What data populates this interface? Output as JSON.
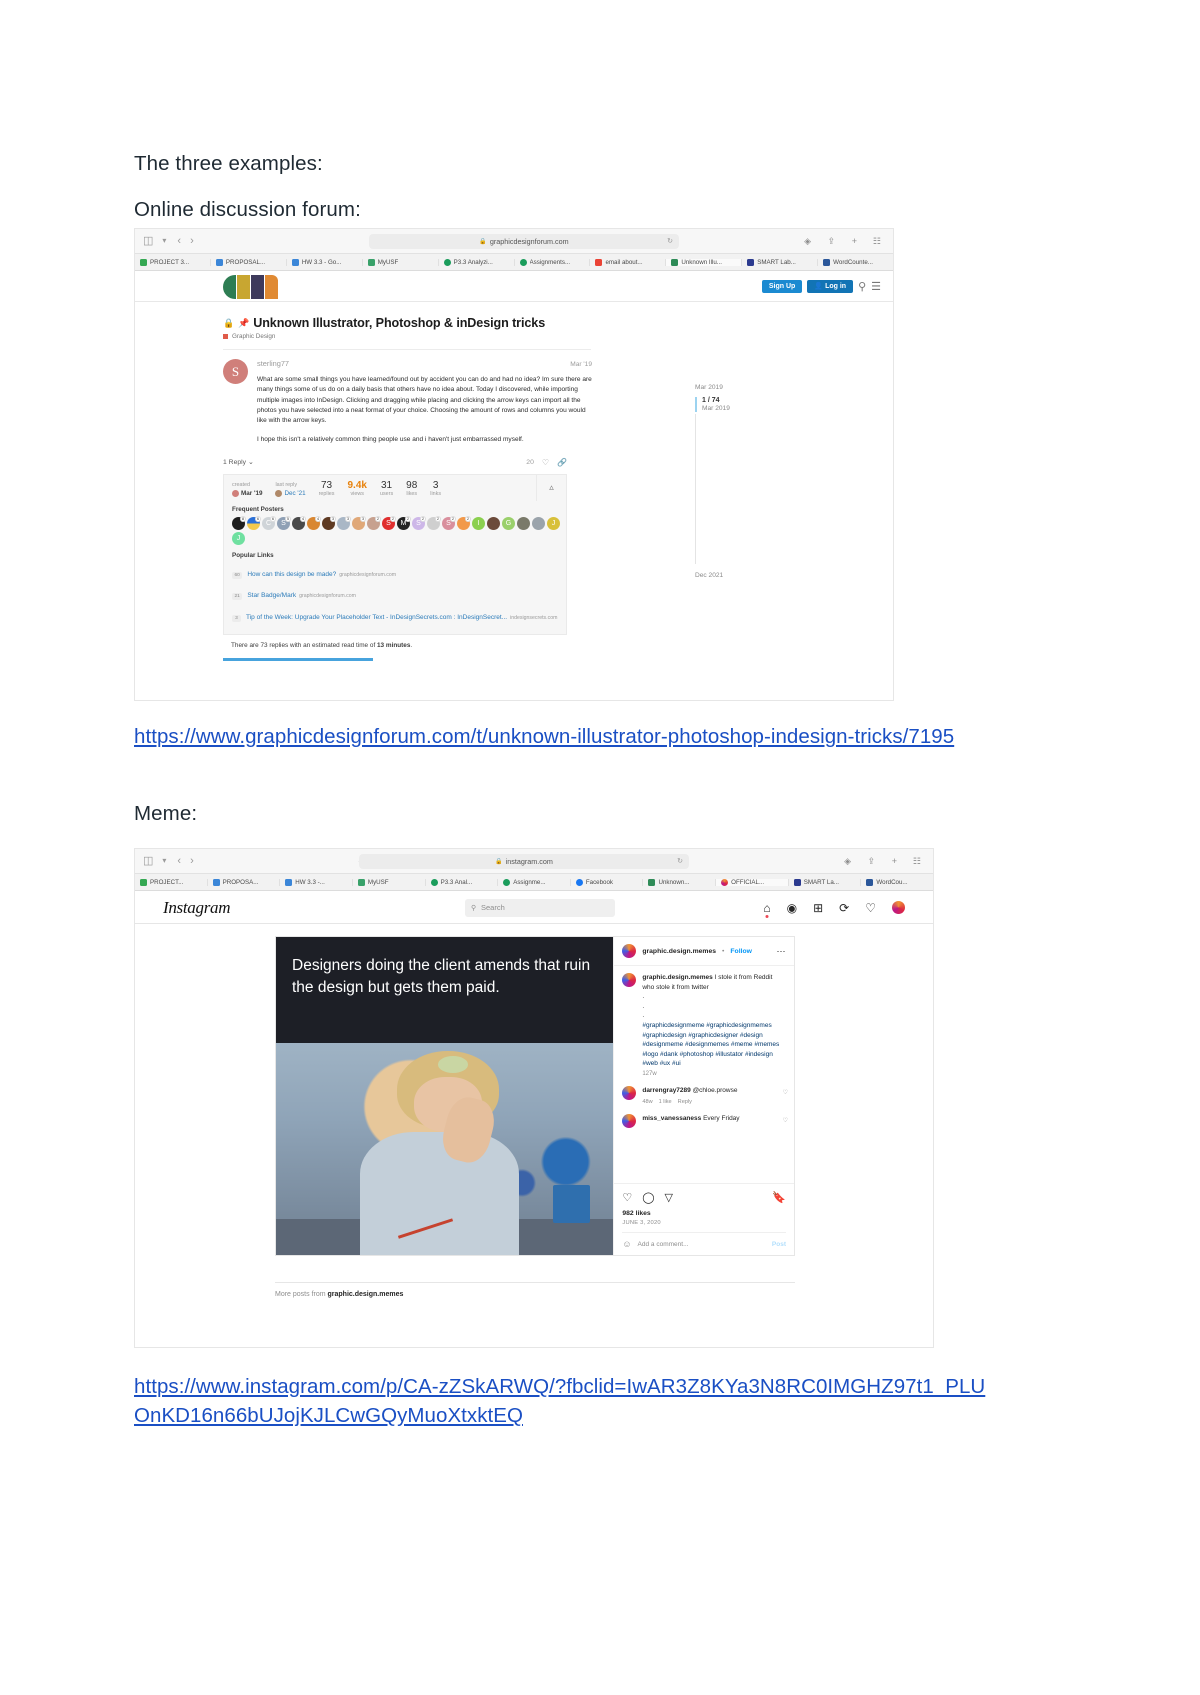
{
  "document": {
    "heading": "The three examples:",
    "section1_label": "Online discussion forum:",
    "link1": "https://www.graphicdesignforum.com/t/unknown-illustrator-photoshop-indesign-tricks/7195",
    "section2_label": "Meme:",
    "link2": "https://www.instagram.com/p/CA-zZSkARWQ/?fbclid=IwAR3Z8KYa3N8RC0IMGHZ97t1_PLUOnKD16n66bUJojKJLCwGQyMuoXtxktEQ"
  },
  "forum_browser": {
    "address": "graphicdesignforum.com",
    "lock_icon": "lock-icon",
    "reload_icon": "reload-icon",
    "sidebar_icon": "sidebar-icon",
    "back_icon": "back-arrow-icon",
    "forward_icon": "forward-arrow-icon",
    "contrast_icon": "reader-contrast-icon",
    "download_icon": "download-icon",
    "share_icon": "share-icon",
    "newtab_icon": "plus-icon",
    "tabs_icon": "tab-overview-icon",
    "bookmarks": [
      {
        "label": "PROJECT 3...",
        "color": "#35a853"
      },
      {
        "label": "PROPOSAL...",
        "color": "#3b86d8"
      },
      {
        "label": "HW 3.3 - Go...",
        "color": "#3b86d8"
      },
      {
        "label": "MyUSF",
        "color": "#38a169"
      },
      {
        "label": "P3.3 Analyzi...",
        "color": "#1a9c5b"
      },
      {
        "label": "Assignments...",
        "color": "#1a9c5b"
      },
      {
        "label": "email about...",
        "color": "#ea4335"
      },
      {
        "label": "Unknown Illu...",
        "color": "#2e8b57"
      },
      {
        "label": "SMART Lab...",
        "color": "#2b3a8f"
      },
      {
        "label": "WordCounte...",
        "color": "#2b579a"
      }
    ],
    "active_bookmark_index": 7
  },
  "forum": {
    "brand_name": "graphic-design-forum-logo",
    "signup_label": "Sign Up",
    "login_label": "Log in",
    "search_icon": "search-icon",
    "menu_icon": "hamburger-menu-icon",
    "topic_title": "Unknown Illustrator, Photoshop & inDesign tricks",
    "lock_icon": "lock-icon",
    "pin_icon": "pin-icon",
    "category": "Graphic Design",
    "post": {
      "author": "sterling77",
      "author_initial": "S",
      "date": "Mar '19",
      "paragraph1": "What are some small things you have learned/found out by accident you can do and had no idea? Im sure there are many things some of us do on a daily basis that others have no idea about. Today I discovered, while importing multiple images into InDesign. Clicking and dragging while placing and clicking the arrow keys can import all the photos you have selected into a neat format of your choice. Choosing the amount of rows and columns you would like with the arrow keys.",
      "paragraph2": "I hope this isn't a relatively common thing people use and i haven't just embarrassed myself."
    },
    "reply_toggle": "1 Reply",
    "like_count": "20",
    "heart_icon": "heart-icon",
    "link_icon": "link-icon",
    "chevron_down_icon": "chevron-down-icon",
    "stats": {
      "created_label": "created",
      "created_value": "Mar '19",
      "last_reply_label": "last reply",
      "last_reply_value": "Dec '21",
      "counters": [
        {
          "value": "73",
          "label": "replies",
          "hot": false
        },
        {
          "value": "9.4k",
          "label": "views",
          "hot": true
        },
        {
          "value": "31",
          "label": "users",
          "hot": false
        },
        {
          "value": "98",
          "label": "likes",
          "hot": false
        },
        {
          "value": "3",
          "label": "links",
          "hot": false
        }
      ],
      "collapse_icon": "chevron-up-icon"
    },
    "frequent_posters_label": "Frequent Posters",
    "frequent_posters": [
      {
        "color": "#1e1e1e",
        "letter": "",
        "badge": "8"
      },
      {
        "color": "#f2c94c",
        "letter": "",
        "badge": "6"
      },
      {
        "color": "#cfd4d8",
        "letter": "C",
        "badge": "6"
      },
      {
        "color": "#8fa0b5",
        "letter": "S",
        "badge": "5"
      },
      {
        "color": "#4a4a4a",
        "letter": "",
        "badge": "4"
      },
      {
        "color": "#d98732",
        "letter": "",
        "badge": "4"
      },
      {
        "color": "#5e3a22",
        "letter": "",
        "badge": "3"
      },
      {
        "color": "#a9b7c6",
        "letter": "",
        "badge": "3"
      },
      {
        "color": "#e0a878",
        "letter": "",
        "badge": "3"
      },
      {
        "color": "#c7a18f",
        "letter": "",
        "badge": "2"
      },
      {
        "color": "#e02f2f",
        "letter": "S",
        "badge": "2"
      },
      {
        "color": "#222222",
        "letter": "M",
        "badge": "2"
      },
      {
        "color": "#cdb7e8",
        "letter": "S",
        "badge": "2"
      },
      {
        "color": "#cfcfcf",
        "letter": "",
        "badge": "2"
      },
      {
        "color": "#d98f9d",
        "letter": "S",
        "badge": "2"
      },
      {
        "color": "#f2994a",
        "letter": "",
        "badge": "2"
      },
      {
        "color": "#8bd04f",
        "letter": "I",
        "badge": ""
      },
      {
        "color": "#6b4a3a",
        "letter": "",
        "badge": ""
      },
      {
        "color": "#9ad06b",
        "letter": "G",
        "badge": ""
      },
      {
        "color": "#7a7a6a",
        "letter": "",
        "badge": ""
      },
      {
        "color": "#9aa3ab",
        "letter": "",
        "badge": ""
      },
      {
        "color": "#d8c03a",
        "letter": "J",
        "badge": ""
      },
      {
        "color": "#6fe0a0",
        "letter": "J",
        "badge": ""
      }
    ],
    "popular_links_label": "Popular Links",
    "popular_links": [
      {
        "count": "60",
        "title": "How can this design be made?",
        "domain": "graphicdesignforum.com",
        "note": ""
      },
      {
        "count": "21",
        "title": "Star Badge/Mark",
        "domain": "graphicdesignforum.com",
        "note": ""
      },
      {
        "count": "3",
        "title": "Tip of the Week: Upgrade Your Placeholder Text - InDesignSecrets.com : InDesignSecret...",
        "domain": "",
        "note": "indesignsecrets.com"
      }
    ],
    "estimate_text_pre": "There are 73 replies with an estimated read time of ",
    "estimate_text_bold": "13 minutes",
    "estimate_text_post": ".",
    "timeline": {
      "top_date": "Mar 2019",
      "position": "1 / 74",
      "position_date": "Mar 2019",
      "bottom_date": "Dec 2021"
    }
  },
  "insta_browser": {
    "address": "instagram.com",
    "bookmarks": [
      {
        "label": "PROJECT...",
        "color": "#35a853"
      },
      {
        "label": "PROPOSA...",
        "color": "#3b86d8"
      },
      {
        "label": "HW 3.3 -...",
        "color": "#3b86d8"
      },
      {
        "label": "MyUSF",
        "color": "#38a169"
      },
      {
        "label": "P3.3 Anal...",
        "color": "#1a9c5b"
      },
      {
        "label": "Assignme...",
        "color": "#1a9c5b"
      },
      {
        "label": "Facebook",
        "color": "#1877f2"
      },
      {
        "label": "Unknown...",
        "color": "#2e8b57"
      },
      {
        "label": "OFFICIAL...",
        "color": "#dd2a7b"
      },
      {
        "label": "SMART La...",
        "color": "#2b3a8f"
      },
      {
        "label": "WordCou...",
        "color": "#2b579a"
      }
    ],
    "active_bookmark_index": 8
  },
  "instagram": {
    "logo": "Instagram",
    "search_placeholder": "Search",
    "search_icon": "search-icon",
    "nav_icons": [
      "home-icon",
      "messenger-icon",
      "new-post-icon",
      "explore-icon",
      "activity-heart-icon",
      "profile-avatar"
    ],
    "meme_text": "Designers doing the client amends that ruin the design but gets them paid.",
    "account": "graphic.design.memes",
    "follow_label": "Follow",
    "separator": "•",
    "more_icon": "more-options-icon",
    "caption_author": "graphic.design.memes",
    "caption_text": "I stole it from Reddit who stole it from twitter",
    "caption_dots": [
      ".",
      ".",
      "."
    ],
    "caption_hashtags": "#graphicdesignmeme #graphicdesignmemes #graphicdesign #graphicdesigner #design #designmeme #designmemes #meme #memes #logo #dank #photoshop #illustator #indesign #web #ux #ui",
    "caption_time": "127w",
    "comments": [
      {
        "author": "darrengray7289",
        "text": "@chloe.prowse",
        "meta": [
          "48w",
          "1 like",
          "Reply"
        ]
      },
      {
        "author": "miss_vanessaness",
        "text": "Every Friday",
        "meta": []
      }
    ],
    "action_icons": [
      "heart-icon",
      "comment-icon",
      "share-icon",
      "bookmark-icon"
    ],
    "likes": "982 likes",
    "date": "JUNE 3, 2020",
    "add_comment_placeholder": "Add a comment...",
    "post_label": "Post",
    "emoji_icon": "emoji-icon",
    "more_posts_pre": "More posts from ",
    "more_posts_account": "graphic.design.memes"
  }
}
